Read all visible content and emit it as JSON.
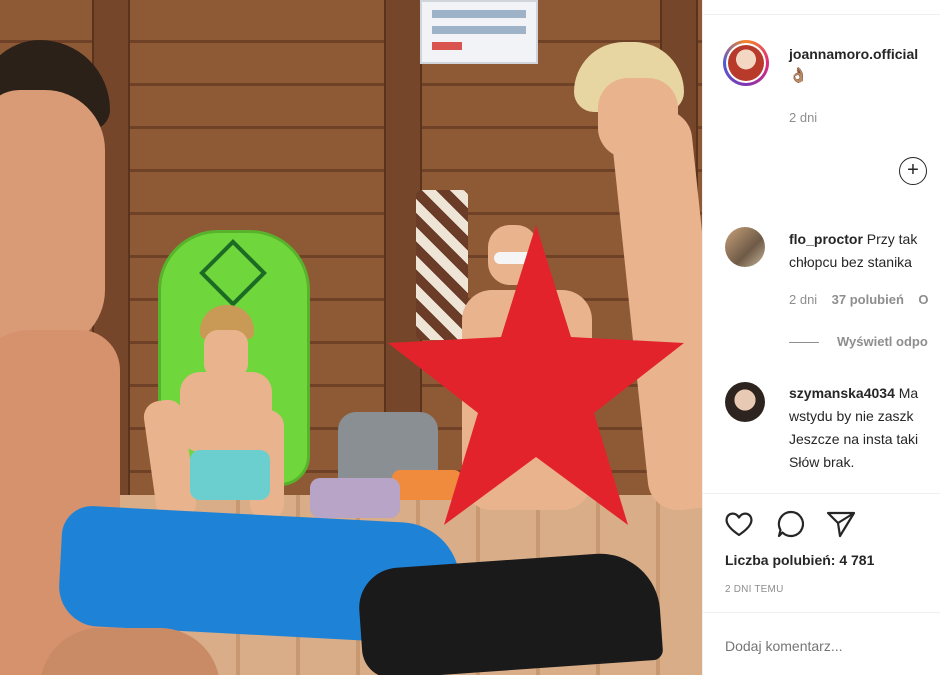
{
  "post": {
    "username": "joannamoro.official",
    "caption_emoji": "👌🏽",
    "time_ago": "2 dni"
  },
  "comments": [
    {
      "username": "flo_proctor",
      "text_line1": "Przy tak",
      "text_line2": "chłopcu bez stanika",
      "time": "2 dni",
      "likes": "37 polubień",
      "reply_label": "O",
      "view_replies": "Wyświetl odpo"
    },
    {
      "username": "szymanska4034",
      "text_line1": "Ma",
      "text_line2": "wstydu by nie zaszk",
      "text_line3": "Jeszcze na insta taki",
      "text_line4": "Słów brak."
    }
  ],
  "actions": {
    "like_icon": "heart-icon",
    "comment_icon": "comment-bubble-icon",
    "share_icon": "paper-plane-icon",
    "plus_icon": "plus-circle-icon"
  },
  "likes_label": "Liczba polubień: 4 781",
  "date_label": "2 DNI TEMU",
  "add_comment_placeholder": "Dodaj komentarz...",
  "colors": {
    "star": "#e3232c",
    "towel": "#1e83d6",
    "bodyboard": "#6fd63b",
    "text_secondary": "#8e8e8e"
  }
}
